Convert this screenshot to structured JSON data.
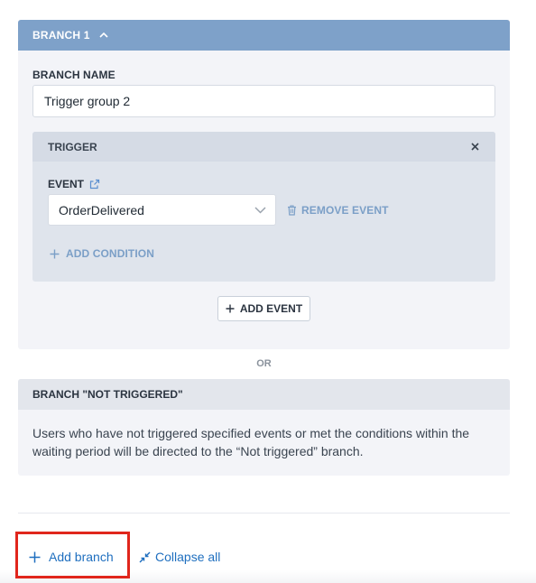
{
  "branch": {
    "title": "BRANCH 1",
    "name_label": "BRANCH NAME",
    "name_value": "Trigger group 2",
    "trigger": {
      "title": "TRIGGER",
      "event_label": "EVENT",
      "event_value": "OrderDelivered",
      "remove_event_label": "REMOVE EVENT",
      "add_condition_label": "ADD CONDITION"
    },
    "add_event_label": "ADD EVENT"
  },
  "or_label": "OR",
  "not_triggered": {
    "title": "BRANCH \"NOT TRIGGERED\"",
    "description": "Users who have not triggered specified events or met the conditions within the waiting period will be directed to the “Not triggered” branch."
  },
  "footer": {
    "add_branch_label": "Add branch",
    "collapse_all_label": "Collapse all"
  },
  "icons": {
    "branch_toggle": "chevron-up-icon",
    "trigger_close": "close-icon",
    "event_link": "external-link-icon",
    "event_dropdown": "chevron-down-icon",
    "remove_event": "trash-icon",
    "add_condition": "plus-icon",
    "add_event": "plus-icon",
    "add_branch": "plus-icon",
    "collapse_all": "collapse-arrows-icon"
  },
  "colors": {
    "branch_header": "#7ea1c9",
    "link_muted": "#7b9fc7",
    "link_primary": "#1f6fbf",
    "highlight": "#e0261c"
  }
}
